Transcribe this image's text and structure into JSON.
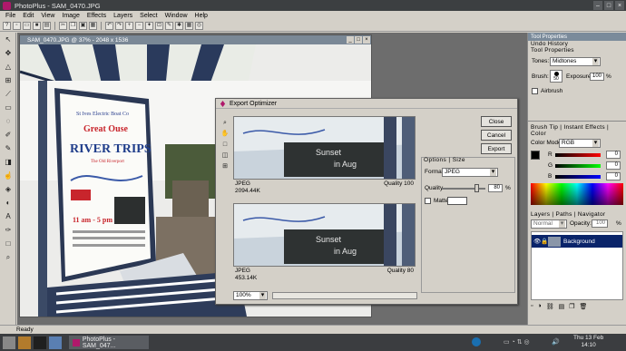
{
  "app": {
    "title": "PhotoPlus - SAM_0470.JPG",
    "menu": [
      "File",
      "Edit",
      "View",
      "Image",
      "Effects",
      "Layers",
      "Select",
      "Window",
      "Help"
    ]
  },
  "document": {
    "title": "SAM_0470.JPG @ 37% - 2048 x 1536"
  },
  "image_sign": {
    "line1": "St Ives Electric Boat Co",
    "line2": "Great Ouse",
    "line3": "RIVER TRIPS",
    "line4": "The Old Riverport",
    "times": "11 am - 5 pm"
  },
  "export_dialog": {
    "title": "Export Optimizer",
    "buttons": {
      "close": "Close",
      "cancel": "Cancel",
      "export": "Export"
    },
    "preview1": {
      "format": "JPEG",
      "size": "2094.44K",
      "quality": "Quality 100"
    },
    "preview2": {
      "format": "JPEG",
      "size": "453.14K",
      "quality": "Quality 80"
    },
    "tabs": "Options | Size",
    "format_label": "Format:",
    "format_value": "JPEG",
    "quality_label": "Quality",
    "quality_value": "80",
    "quality_unit": "%",
    "matte_label": "Matte",
    "zoom": "100%"
  },
  "tool_properties": {
    "header": "Tool Properties",
    "tabs1": "Undo History",
    "tabs2": "Tool Properties",
    "tones_label": "Tones:",
    "tones_value": "Midtones",
    "brush_label": "Brush:",
    "brush_size": "50",
    "exposure_label": "Exposure:",
    "exposure_value": "100",
    "exposure_unit": "%",
    "airbrush_label": "Airbrush"
  },
  "color_panel": {
    "tabs": "Brush Tip | Instant Effects | Color",
    "mode_label": "Color Mode:",
    "mode_value": "RGB",
    "r": "0",
    "g": "0",
    "b": "0",
    "r_label": "R",
    "g_label": "G",
    "b_label": "B"
  },
  "layers_panel": {
    "tabs": "Layers | Paths | Navigator",
    "blend": "Normal",
    "opacity_label": "Opacity:",
    "opacity_value": "100",
    "opacity_unit": "%",
    "layer_name": "Background"
  },
  "status": "Ready",
  "taskbar": {
    "task": "PhotoPlus - SAM_047...",
    "date": "Thu 13 Feb",
    "time": "14:10"
  },
  "colors": {
    "accent": "#0a246a",
    "title_bg": "#7b8b9b",
    "sign_blue": "#1f3d8a",
    "sign_red": "#c8252c"
  }
}
